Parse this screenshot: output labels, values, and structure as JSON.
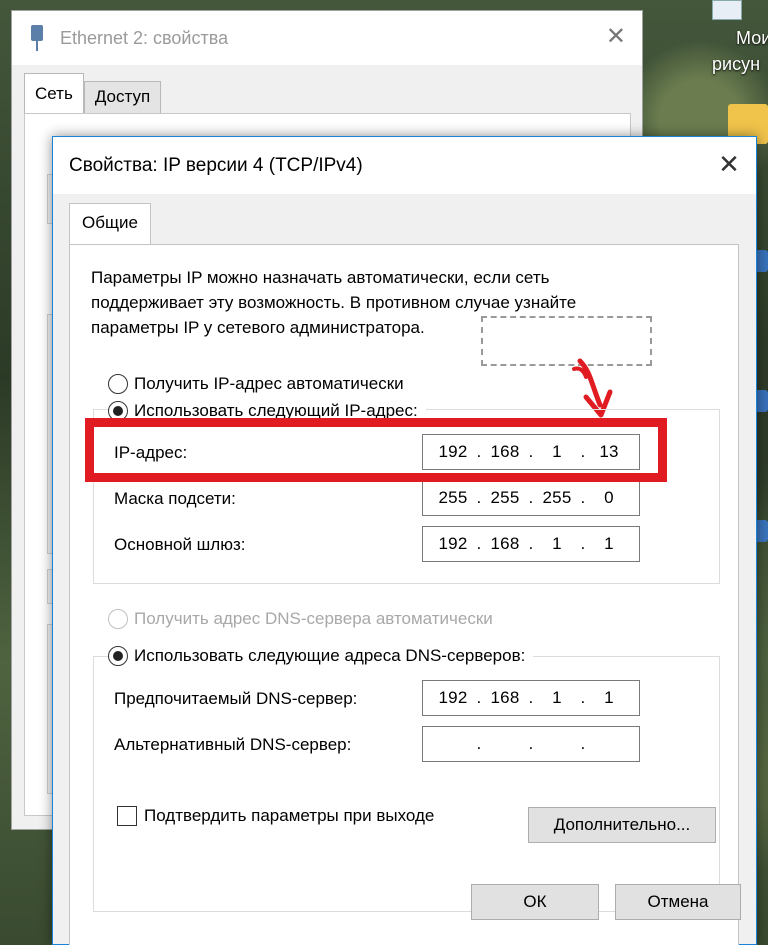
{
  "background_window": {
    "title": "Ethernet 2: свойства",
    "tabs": [
      "Сеть",
      "Доступ"
    ]
  },
  "desktop": {
    "labels": [
      "Мои",
      "рисун"
    ]
  },
  "dialog": {
    "title": "Свойства: IP версии 4 (TCP/IPv4)",
    "tab": "Общие",
    "intro_lines": [
      "Параметры IP можно назначать автоматически, если сеть",
      "поддерживает эту возможность. В противном случае узнайте",
      "параметры IP у сетевого администратора."
    ],
    "ip_section": {
      "auto_label": "Получить IP-адрес автоматически",
      "manual_label": "Использовать следующий IP-адрес:",
      "selected": "manual",
      "fields": [
        {
          "label": "IP-адрес:",
          "octets": [
            "192",
            "168",
            "1",
            "13"
          ]
        },
        {
          "label": "Маска подсети:",
          "octets": [
            "255",
            "255",
            "255",
            "0"
          ]
        },
        {
          "label": "Основной шлюз:",
          "octets": [
            "192",
            "168",
            "1",
            "1"
          ]
        }
      ]
    },
    "dns_section": {
      "auto_label": "Получить адрес DNS-сервера автоматически",
      "manual_label": "Использовать следующие адреса DNS-серверов:",
      "selected": "manual",
      "fields": [
        {
          "label": "Предпочитаемый DNS-сервер:",
          "octets": [
            "192",
            "168",
            "1",
            "1"
          ]
        },
        {
          "label": "Альтернативный DNS-сервер:",
          "octets": [
            "",
            "",
            "",
            ""
          ]
        }
      ]
    },
    "validate_label": "Подтвердить параметры при выходе",
    "advanced_button": "Дополнительно...",
    "ok_button": "ОК",
    "cancel_button": "Отмена"
  },
  "annotation": {
    "highlight_color": "#e01b22",
    "arrow_color": "#e01b22"
  }
}
